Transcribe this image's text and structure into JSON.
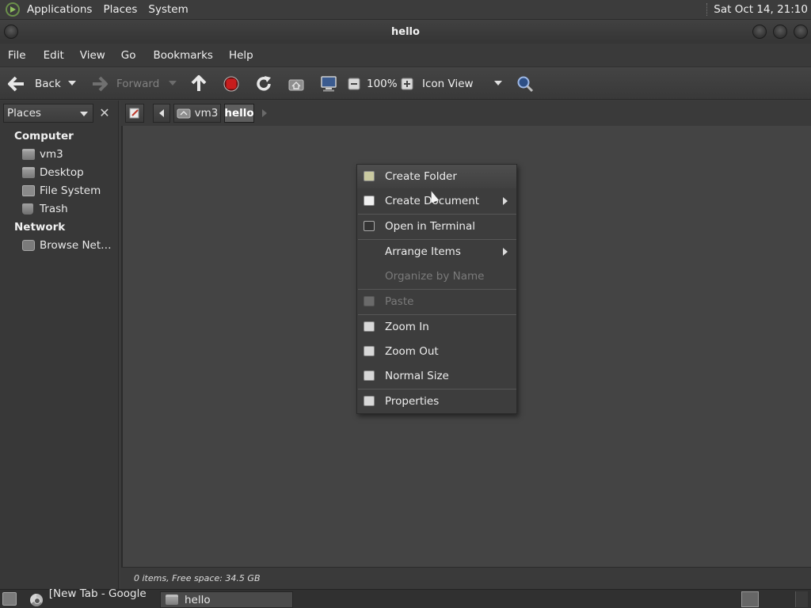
{
  "top_panel": {
    "menus": [
      "Applications",
      "Places",
      "System"
    ],
    "clock": "Sat Oct 14, 21:10"
  },
  "window": {
    "title": "hello"
  },
  "menubar": [
    "File",
    "Edit",
    "View",
    "Go",
    "Bookmarks",
    "Help"
  ],
  "toolbar": {
    "back_label": "Back",
    "forward_label": "Forward",
    "zoom_level": "100%",
    "view_mode": "Icon View"
  },
  "sidepane": {
    "combo_label": "Places",
    "close_glyph": "✕",
    "sections": [
      {
        "title": "Computer",
        "items": [
          "vm3",
          "Desktop",
          "File System",
          "Trash"
        ]
      },
      {
        "title": "Network",
        "items": [
          "Browse Net…"
        ]
      }
    ]
  },
  "location": {
    "crumbs": [
      "vm3",
      "hello"
    ],
    "active": "hello"
  },
  "status": {
    "text": "0 items, Free space: 34.5 GB"
  },
  "context_menu": {
    "items": [
      {
        "label": "Create Folder",
        "icon": "folder-new-icon",
        "submenu": false,
        "enabled": true
      },
      {
        "label": "Create Document",
        "icon": "document-new-icon",
        "submenu": true,
        "enabled": true
      },
      {
        "label": "Open in Terminal",
        "icon": "terminal-icon",
        "submenu": false,
        "enabled": true
      },
      {
        "label": "Arrange Items",
        "icon": "",
        "submenu": true,
        "enabled": true
      },
      {
        "label": "Organize by Name",
        "icon": "",
        "submenu": false,
        "enabled": false
      },
      {
        "label": "Paste",
        "icon": "paste-icon",
        "submenu": false,
        "enabled": false
      },
      {
        "label": "Zoom In",
        "icon": "zoom-in-icon",
        "submenu": false,
        "enabled": true
      },
      {
        "label": "Zoom Out",
        "icon": "zoom-out-icon",
        "submenu": false,
        "enabled": true
      },
      {
        "label": "Normal Size",
        "icon": "zoom-normal-icon",
        "submenu": false,
        "enabled": true
      },
      {
        "label": "Properties",
        "icon": "properties-icon",
        "submenu": false,
        "enabled": true
      }
    ]
  },
  "taskbar": {
    "tasks": [
      "[New Tab - Google …",
      "hello"
    ]
  }
}
